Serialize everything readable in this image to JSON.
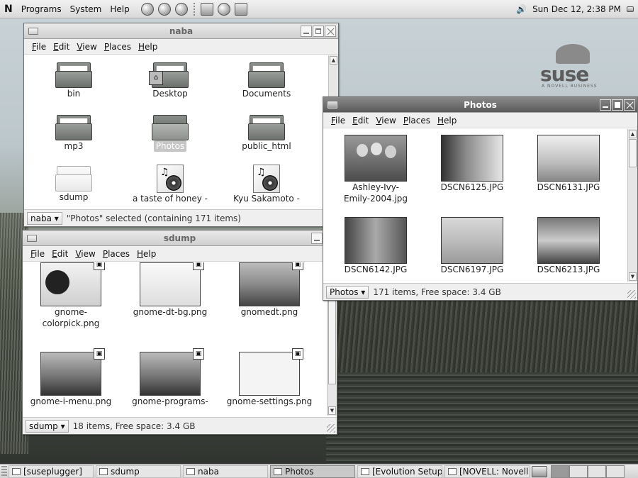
{
  "top_panel": {
    "logo": "N",
    "menus": [
      "Programs",
      "System",
      "Help"
    ],
    "clock": "Sun Dec 12,  2:38 PM",
    "volume_icon": "volume-icon"
  },
  "naba_window": {
    "title": "naba",
    "menu": [
      "File",
      "Edit",
      "View",
      "Places",
      "Help"
    ],
    "items": [
      {
        "label": "bin",
        "icon": "folder"
      },
      {
        "label": "Desktop",
        "icon": "folder"
      },
      {
        "label": "Documents",
        "icon": "folder"
      },
      {
        "label": "mp3",
        "icon": "folder"
      },
      {
        "label": "Photos",
        "icon": "folder",
        "selected": true
      },
      {
        "label": "public_html",
        "icon": "folder"
      },
      {
        "label": "sdump",
        "icon": "folder"
      },
      {
        "label": "a taste of honey -",
        "icon": "audio-file"
      },
      {
        "label": "Kyu Sakamoto -",
        "icon": "audio-file"
      }
    ],
    "location": "naba",
    "status": "\"Photos\" selected (containing 171 items)"
  },
  "photos_window": {
    "title": "Photos",
    "menu": [
      "File",
      "Edit",
      "View",
      "Places",
      "Help"
    ],
    "items": [
      {
        "label_line1": "Ashley-Ivy-",
        "label_line2": "Emily-2004.jpg"
      },
      {
        "label_line1": "DSCN6125.JPG",
        "label_line2": ""
      },
      {
        "label_line1": "DSCN6131.JPG",
        "label_line2": ""
      },
      {
        "label_line1": "DSCN6142.JPG",
        "label_line2": ""
      },
      {
        "label_line1": "DSCN6197.JPG",
        "label_line2": ""
      },
      {
        "label_line1": "DSCN6213.JPG",
        "label_line2": ""
      }
    ],
    "location": "Photos",
    "status": "171 items, Free space: 3.4 GB"
  },
  "sdump_window": {
    "title": "sdump",
    "menu": [
      "File",
      "Edit",
      "View",
      "Places",
      "Help"
    ],
    "items": [
      {
        "label_line1": "gnome-",
        "label_line2": "colorpick.png"
      },
      {
        "label_line1": "gnome-dt-bg.png",
        "label_line2": ""
      },
      {
        "label_line1": "gnomedt.png",
        "label_line2": ""
      },
      {
        "label_line1": "gnome-i-menu.png",
        "label_line2": ""
      },
      {
        "label_line1": "gnome-programs-",
        "label_line2": ""
      },
      {
        "label_line1": "gnome-settings.png",
        "label_line2": ""
      }
    ],
    "location": "sdump",
    "status": "18 items, Free space: 3.4 GB"
  },
  "branding": {
    "word": "suse",
    "tagline": "A NOVELL BUSINESS"
  },
  "taskbar": {
    "tasks": [
      {
        "label": "[suseplugger]"
      },
      {
        "label": "sdump"
      },
      {
        "label": "naba"
      },
      {
        "label": "Photos",
        "active": true
      },
      {
        "label": "[Evolution Setup A"
      },
      {
        "label": "[NOVELL: Novell c"
      }
    ]
  }
}
